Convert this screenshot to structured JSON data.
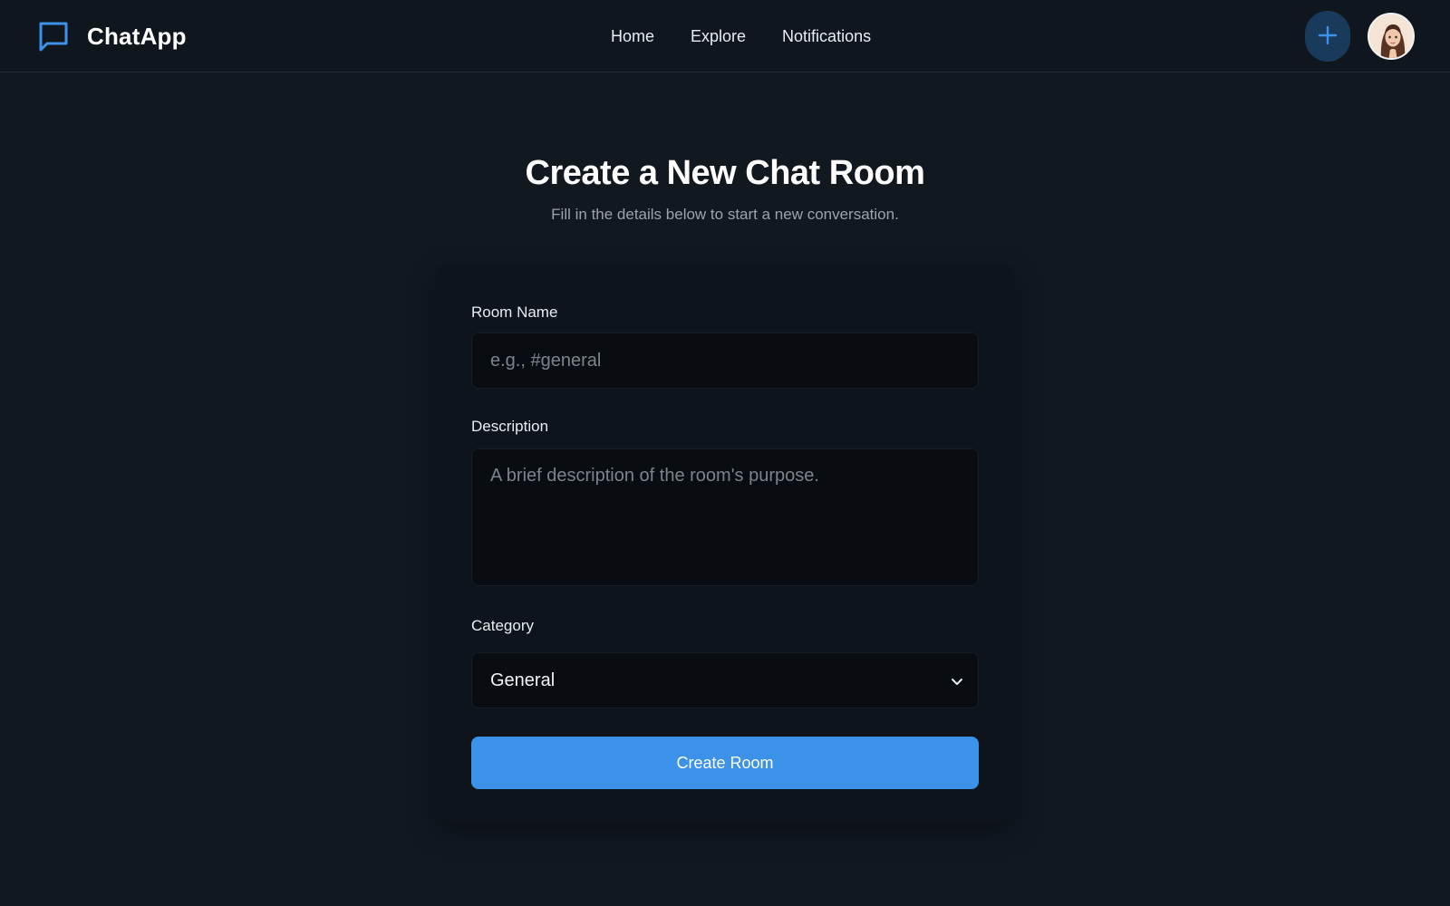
{
  "app": {
    "name": "ChatApp",
    "logo_icon": "chat-bubble-icon",
    "accent_color": "#3b92e8"
  },
  "nav": {
    "items": [
      {
        "label": "Home"
      },
      {
        "label": "Explore"
      },
      {
        "label": "Notifications"
      }
    ]
  },
  "header_actions": {
    "add_icon": "plus-icon",
    "avatar_icon": "user-avatar"
  },
  "page": {
    "title": "Create a New Chat Room",
    "subtitle": "Fill in the details below to start a new conversation."
  },
  "form": {
    "room_name": {
      "label": "Room Name",
      "value": "",
      "placeholder": "e.g., #general"
    },
    "description": {
      "label": "Description",
      "value": "",
      "placeholder": "A brief description of the room's purpose."
    },
    "category": {
      "label": "Category",
      "selected": "General",
      "chevron_icon": "chevron-down-icon"
    },
    "submit_label": "Create Room"
  }
}
